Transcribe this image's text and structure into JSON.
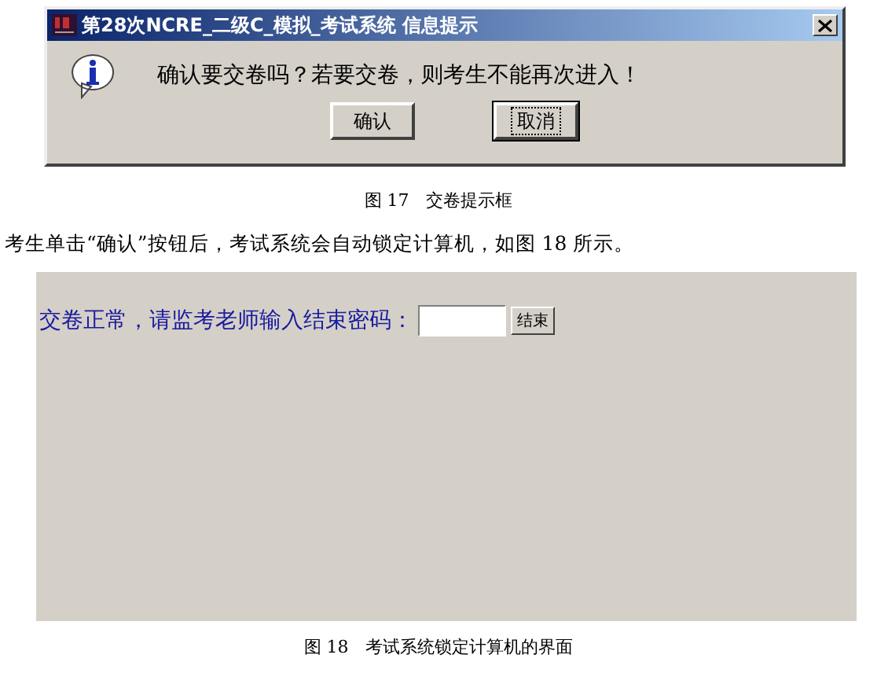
{
  "figure_1": {
    "window": {
      "title": "第28次NCRE_二级C_模拟_考试系统 信息提示"
    },
    "message": "确认要交卷吗？若要交卷，则考生不能再次进入！",
    "buttons": [
      {
        "label": "确认",
        "focused": false
      },
      {
        "label": "取消",
        "focused": true
      }
    ],
    "caption": "图 17　交卷提示框"
  },
  "paragraph": "考生单击“确认”按钮后，考试系统会自动锁定计算机，如图 18 所示。",
  "figure_2": {
    "prompt": "交卷正常，请监考老师输入结束密码：",
    "button": "结束",
    "caption": "图 18　考试系统锁定计算机的界面"
  }
}
